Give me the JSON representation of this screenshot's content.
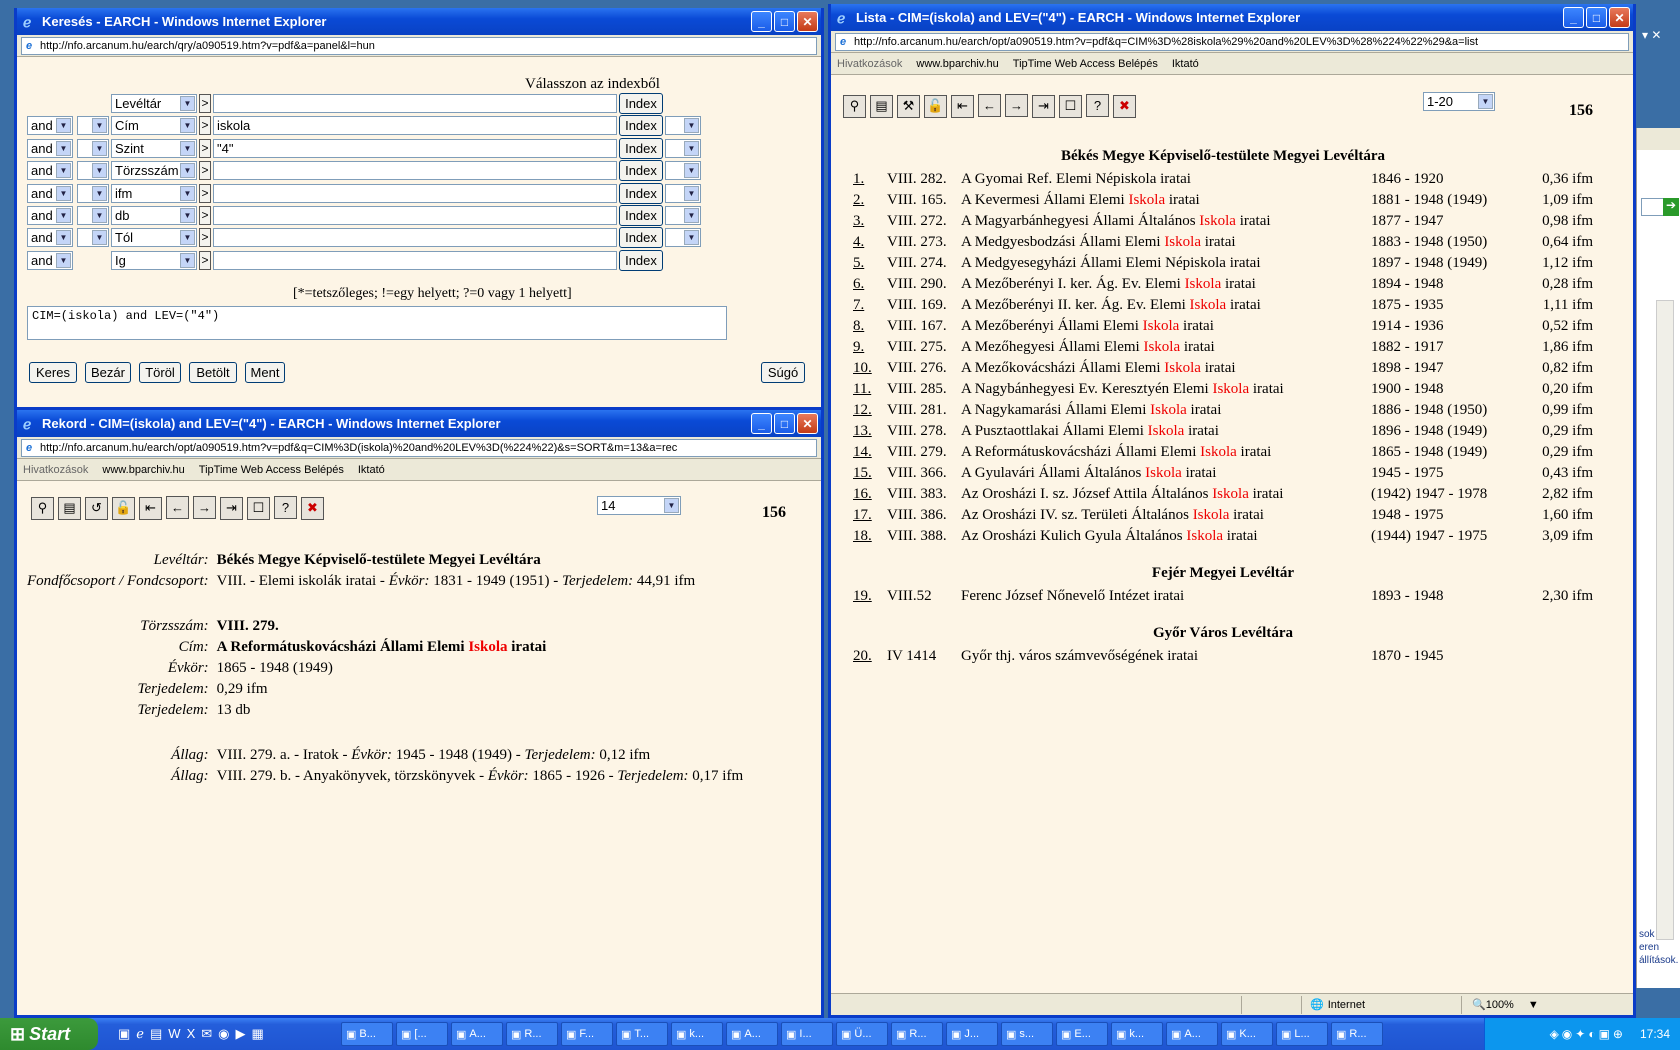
{
  "search_window": {
    "title": "Keresés - EARCH - Windows Internet Explorer",
    "url": "http://nfo.arcanum.hu/earch/qry/a090519.htm?v=pdf&a=panel&l=hun",
    "index_header": "Válasszon az indexből",
    "rows": [
      {
        "op": "",
        "field": "Levéltár",
        "value": ""
      },
      {
        "op": "and",
        "field": "Cím",
        "value": "iskola"
      },
      {
        "op": "and",
        "field": "Szint",
        "value": "\"4\""
      },
      {
        "op": "and",
        "field": "Törzsszám",
        "value": ""
      },
      {
        "op": "and",
        "field": "ifm",
        "value": ""
      },
      {
        "op": "and",
        "field": "db",
        "value": ""
      },
      {
        "op": "and",
        "field": "Tól",
        "value": ""
      },
      {
        "op": "and",
        "field": "Ig",
        "value": ""
      }
    ],
    "index_label": "Index",
    "gt_label": ">",
    "hint": "[*=tetszőleges; !=egy helyett; ?=0 vagy 1 helyett]",
    "query": "CIM=(iskola) and LEV=(\"4\")",
    "buttons": {
      "search": "Keres",
      "close": "Bezár",
      "delete": "Töröl",
      "load": "Betölt",
      "save": "Ment",
      "help": "Súgó"
    }
  },
  "record_window": {
    "title": "Rekord - CIM=(iskola) and LEV=(\"4\") - EARCH - Windows Internet Explorer",
    "url": "http://nfo.arcanum.hu/earch/opt/a090519.htm?v=pdf&q=CIM%3D(iskola)%20and%20LEV%3D(%224%22)&s=SORT&m=13&a=rec",
    "links": {
      "label": "Hivatkozások",
      "l1": "www.bparchiv.hu",
      "l2": "TipTime Web Access Belépés",
      "l3": "Iktató"
    },
    "page_select": "14",
    "total": "156",
    "archive_label": "Levéltár:",
    "archive": "Békés Megye Képviselő-testülete Megyei Levéltára",
    "fond_label": "Fondfőcsoport / Fondcsoport:",
    "fond_pre": "VIII. - Elemi iskolák iratai - ",
    "evkor_label": "Évkör:",
    "fond_years": " 1831 - 1949 (1951) - ",
    "terj_label": "Terjedelem:",
    "fond_size": " 44,91 ifm",
    "torzs_label": "Törzsszám:",
    "torzs": "VIII. 279.",
    "cim_label": "Cím:",
    "cim_pre": "A Reformátuskovácsházi Állami Elemi ",
    "cim_hl": "Iskola",
    "cim_post": " iratai",
    "evkor2_label": "Évkör:",
    "evkor2": "1865 - 1948 (1949)",
    "terj1_label": "Terjedelem:",
    "terj1": "0,29 ifm",
    "terj2_label": "Terjedelem:",
    "terj2": "13 db",
    "allag_label": "Állag:",
    "allag1_pre": "VIII. 279. a. - Iratok - ",
    "allag1_years": " 1945 - 1948 (1949) - ",
    "allag1_size": " 0,12 ifm",
    "allag2_pre": "VIII. 279. b. - Anyakönyvek, törzskönyvek - ",
    "allag2_years": " 1865 - 1926 - ",
    "allag2_size": " 0,17 ifm"
  },
  "list_window": {
    "title": "Lista - CIM=(iskola) and LEV=(\"4\") - EARCH - Windows Internet Explorer",
    "url": "http://nfo.arcanum.hu/earch/opt/a090519.htm?v=pdf&q=CIM%3D%28iskola%29%20and%20LEV%3D%28%224%22%29&a=list",
    "links": {
      "label": "Hivatkozások",
      "l1": "www.bparchiv.hu",
      "l2": "TipTime Web Access Belépés",
      "l3": "Iktató"
    },
    "range_select": "1-20",
    "total": "156",
    "groups": [
      {
        "title": "Békés Megye Képviselő-testülete Megyei Levéltára",
        "items": [
          {
            "n": "1.",
            "code": "VIII. 282.",
            "pre": "A Gyomai Ref. Elemi Népiskola iratai",
            "hl": "",
            "post": "",
            "years": "1846 - 1920",
            "size": "0,36 ifm"
          },
          {
            "n": "2.",
            "code": "VIII. 165.",
            "pre": "A Kevermesi Állami Elemi ",
            "hl": "Iskola",
            "post": " iratai",
            "years": "1881 - 1948 (1949)",
            "size": "1,09 ifm"
          },
          {
            "n": "3.",
            "code": "VIII. 272.",
            "pre": "A Magyarbánhegyesi Állami Általános ",
            "hl": "Iskola",
            "post": " iratai",
            "years": "1877 - 1947",
            "size": "0,98 ifm"
          },
          {
            "n": "4.",
            "code": "VIII. 273.",
            "pre": "A Medgyesbodzási Állami Elemi ",
            "hl": "Iskola",
            "post": " iratai",
            "years": "1883 - 1948 (1950)",
            "size": "0,64 ifm"
          },
          {
            "n": "5.",
            "code": "VIII. 274.",
            "pre": "A Medgyesegyházi Állami Elemi Népiskola iratai",
            "hl": "",
            "post": "",
            "years": "1897 - 1948 (1949)",
            "size": "1,12 ifm"
          },
          {
            "n": "6.",
            "code": "VIII. 290.",
            "pre": "A Mezőberényi I. ker. Ág. Ev. Elemi ",
            "hl": "Iskola",
            "post": " iratai",
            "years": "1894 - 1948",
            "size": "0,28 ifm"
          },
          {
            "n": "7.",
            "code": "VIII. 169.",
            "pre": "A Mezőberényi II. ker. Ág. Ev. Elemi ",
            "hl": "Iskola",
            "post": " iratai",
            "years": "1875 - 1935",
            "size": "1,11 ifm"
          },
          {
            "n": "8.",
            "code": "VIII. 167.",
            "pre": "A Mezőberényi Állami Elemi ",
            "hl": "Iskola",
            "post": " iratai",
            "years": "1914 - 1936",
            "size": "0,52 ifm"
          },
          {
            "n": "9.",
            "code": "VIII. 275.",
            "pre": "A Mezőhegyesi Állami Elemi ",
            "hl": "Iskola",
            "post": " iratai",
            "years": "1882 - 1917",
            "size": "1,86 ifm"
          },
          {
            "n": "10.",
            "code": "VIII. 276.",
            "pre": "A Mezőkovácsházi Állami Elemi ",
            "hl": "Iskola",
            "post": " iratai",
            "years": "1898 - 1947",
            "size": "0,82 ifm"
          },
          {
            "n": "11.",
            "code": "VIII. 285.",
            "pre": "A Nagybánhegyesi Ev. Keresztyén Elemi ",
            "hl": "Iskola",
            "post": " iratai",
            "years": "1900 - 1948",
            "size": "0,20 ifm"
          },
          {
            "n": "12.",
            "code": "VIII. 281.",
            "pre": "A Nagykamarási Állami Elemi ",
            "hl": "Iskola",
            "post": " iratai",
            "years": "1886 - 1948 (1950)",
            "size": "0,99 ifm"
          },
          {
            "n": "13.",
            "code": "VIII. 278.",
            "pre": "A Pusztaottlakai Állami Elemi ",
            "hl": "Iskola",
            "post": " iratai",
            "years": "1896 - 1948 (1949)",
            "size": "0,29 ifm"
          },
          {
            "n": "14.",
            "code": "VIII. 279.",
            "pre": "A Reformátuskovácsházi Állami Elemi ",
            "hl": "Iskola",
            "post": " iratai",
            "years": "1865 - 1948 (1949)",
            "size": "0,29 ifm"
          },
          {
            "n": "15.",
            "code": "VIII. 366.",
            "pre": "A Gyulavári Állami Általános ",
            "hl": "Iskola",
            "post": " iratai",
            "years": "1945 - 1975",
            "size": "0,43 ifm"
          },
          {
            "n": "16.",
            "code": "VIII. 383.",
            "pre": "Az Orosházi I. sz. József Attila Általános ",
            "hl": "Iskola",
            "post": " iratai",
            "years": "(1942) 1947 - 1978",
            "size": "2,82 ifm"
          },
          {
            "n": "17.",
            "code": "VIII. 386.",
            "pre": "Az Orosházi IV. sz. Területi Általános ",
            "hl": "Iskola",
            "post": " iratai",
            "years": "1948 - 1975",
            "size": "1,60 ifm"
          },
          {
            "n": "18.",
            "code": "VIII. 388.",
            "pre": "Az Orosházi Kulich Gyula Általános ",
            "hl": "Iskola",
            "post": " iratai",
            "years": "(1944) 1947 - 1975",
            "size": "3,09 ifm"
          }
        ]
      },
      {
        "title": "Fejér Megyei Levéltár",
        "items": [
          {
            "n": "19.",
            "code": "VIII.52",
            "pre": "Ferenc József Nőnevelő Intézet iratai",
            "hl": "",
            "post": "",
            "years": "1893 - 1948",
            "size": "2,30 ifm"
          }
        ]
      },
      {
        "title": "Győr Város Levéltára",
        "items": [
          {
            "n": "20.",
            "code": "IV 1414",
            "pre": "Győr thj. város számvevőségének iratai",
            "hl": "",
            "post": "",
            "years": "1870 - 1945",
            "size": ""
          }
        ]
      }
    ],
    "status_zone": "Internet",
    "status_zoom": "100%"
  },
  "bg_window": {
    "lines": [
      "sok az",
      "eren",
      "állítások."
    ]
  },
  "taskbar": {
    "start": "Start",
    "tasks": [
      "B...",
      "[...",
      "A...",
      "R...",
      "F...",
      "T...",
      "k...",
      "A...",
      "I...",
      "Ü...",
      "R...",
      "J...",
      "s...",
      "E...",
      "k...",
      "A...",
      "K...",
      "L...",
      "R..."
    ],
    "clock": "17:34"
  }
}
